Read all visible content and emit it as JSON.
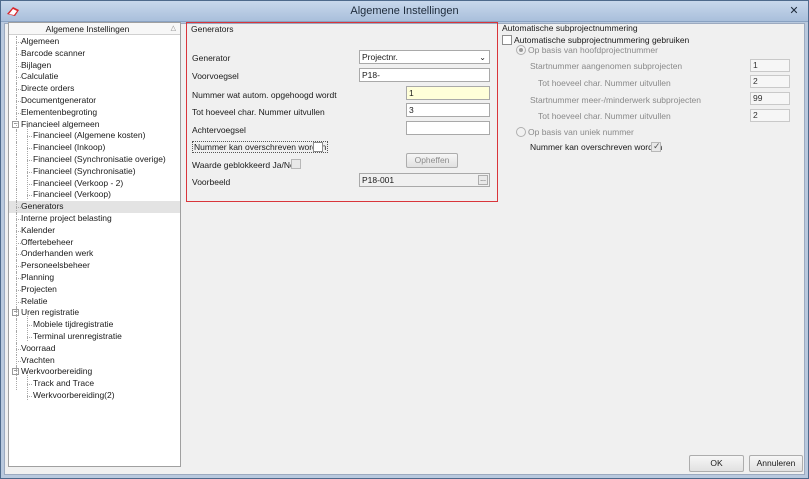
{
  "window": {
    "title": "Algemene Instellingen",
    "close_glyph": "✕"
  },
  "tree": {
    "header": "Algemene Instellingen",
    "items": [
      {
        "label": "Algemeen",
        "level": 0,
        "expandable": false
      },
      {
        "label": "Barcode scanner",
        "level": 0,
        "expandable": false
      },
      {
        "label": "Bijlagen",
        "level": 0,
        "expandable": false
      },
      {
        "label": "Calculatie",
        "level": 0,
        "expandable": false
      },
      {
        "label": "Directe orders",
        "level": 0,
        "expandable": false
      },
      {
        "label": "Documentgenerator",
        "level": 0,
        "expandable": false
      },
      {
        "label": "Elementenbegroting",
        "level": 0,
        "expandable": false
      },
      {
        "label": "Financieel algemeen",
        "level": 0,
        "expandable": true
      },
      {
        "label": "Financieel (Algemene kosten)",
        "level": 1,
        "expandable": false
      },
      {
        "label": "Financieel (Inkoop)",
        "level": 1,
        "expandable": false
      },
      {
        "label": "Financieel (Synchronisatie overige)",
        "level": 1,
        "expandable": false
      },
      {
        "label": "Financieel (Synchronisatie)",
        "level": 1,
        "expandable": false
      },
      {
        "label": "Financieel (Verkoop - 2)",
        "level": 1,
        "expandable": false
      },
      {
        "label": "Financieel (Verkoop)",
        "level": 1,
        "expandable": false
      },
      {
        "label": "Generators",
        "level": 0,
        "expandable": false,
        "selected": true
      },
      {
        "label": "Interne project belasting",
        "level": 0,
        "expandable": false
      },
      {
        "label": "Kalender",
        "level": 0,
        "expandable": false
      },
      {
        "label": "Offertebeheer",
        "level": 0,
        "expandable": false
      },
      {
        "label": "Onderhanden werk",
        "level": 0,
        "expandable": false
      },
      {
        "label": "Personeelsbeheer",
        "level": 0,
        "expandable": false
      },
      {
        "label": "Planning",
        "level": 0,
        "expandable": false
      },
      {
        "label": "Projecten",
        "level": 0,
        "expandable": false
      },
      {
        "label": "Relatie",
        "level": 0,
        "expandable": false
      },
      {
        "label": "Uren registratie",
        "level": 0,
        "expandable": true
      },
      {
        "label": "Mobiele tijdregistratie",
        "level": 1,
        "expandable": false
      },
      {
        "label": "Terminal urenregistratie",
        "level": 1,
        "expandable": false
      },
      {
        "label": "Voorraad",
        "level": 0,
        "expandable": false
      },
      {
        "label": "Vrachten",
        "level": 0,
        "expandable": false
      },
      {
        "label": "Werkvoorbereiding",
        "level": 0,
        "expandable": true
      },
      {
        "label": "Track and Trace",
        "level": 1,
        "expandable": false
      },
      {
        "label": "Werkvoorbereiding(2)",
        "level": 1,
        "expandable": false
      }
    ]
  },
  "generators": {
    "title": "Generators",
    "generator_label": "Generator",
    "generator_value": "Projectnr.",
    "prefix_label": "Voorvoegsel",
    "prefix_value": "P18-",
    "auto_increment_label": "Nummer wat autom. opgehoogd wordt",
    "auto_increment_value": "1",
    "pad_label": "Tot hoeveel char. Nummer uitvullen",
    "pad_value": "3",
    "suffix_label": "Achtervoegsel",
    "suffix_value": "",
    "overwrite_label": "Nummer kan overschreven worden",
    "blocked_label": "Waarde geblokkeerd Ja/Nee",
    "unblock_label": "Opheffen",
    "example_label": "Voorbeeld",
    "example_value": "P18-001",
    "ellipsis": "..."
  },
  "sub": {
    "title": "Automatische subprojectnummering",
    "enable_label": "Automatische subprojectnummering gebruiken",
    "main_radio_label": "Op basis van hoofdprojectnummer",
    "start_accepted_label": "Startnummer aangenomen subprojecten",
    "start_accepted_value": "1",
    "pad1_label": "Tot hoeveel char. Nummer uitvullen",
    "pad1_value": "2",
    "start_extra_label": "Startnummer meer-/minderwerk subprojecten",
    "start_extra_value": "99",
    "pad2_label": "Tot hoeveel char. Nummer uitvullen",
    "pad2_value": "2",
    "unique_radio_label": "Op basis van uniek nummer",
    "overwrite_label": "Nummer kan overschreven worden"
  },
  "footer": {
    "ok_label": "OK",
    "cancel_label": "Annuleren"
  }
}
